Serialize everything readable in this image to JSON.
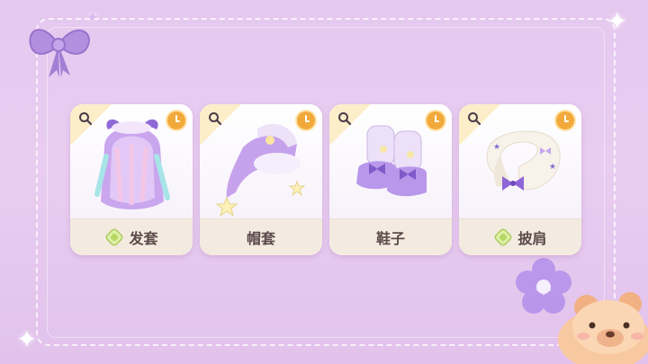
{
  "items": [
    {
      "label": "发套",
      "has_currency_icon": true,
      "icon": "wig-purple-bow"
    },
    {
      "label": "帽套",
      "has_currency_icon": false,
      "icon": "star-nightcap"
    },
    {
      "label": "鞋子",
      "has_currency_icon": false,
      "icon": "purple-shoes"
    },
    {
      "label": "披肩",
      "has_currency_icon": true,
      "icon": "white-shawl"
    }
  ],
  "card_icons": {
    "search": "magnifier-icon",
    "timer": "clock-icon",
    "currency": "gem-coin-icon"
  },
  "colors": {
    "background": "#e6c8ef",
    "card": "#ffffff",
    "label_bar": "#f3ebe0",
    "clock": "#f2a93b",
    "accent_purple": "#b08ad8"
  }
}
